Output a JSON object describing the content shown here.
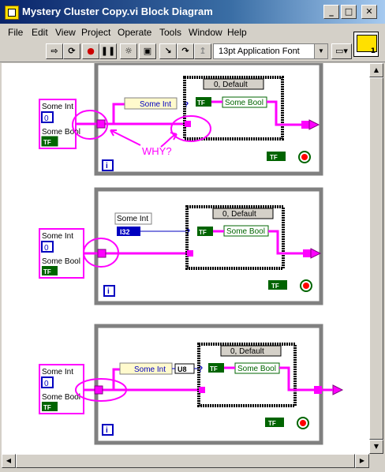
{
  "window": {
    "title": "Mystery Cluster Copy.vi Block Diagram"
  },
  "menu": [
    "File",
    "Edit",
    "View",
    "Project",
    "Operate",
    "Tools",
    "Window",
    "Help"
  ],
  "toolbar": {
    "font_label": "13pt Application Font"
  },
  "vi_icon": {
    "number": "1"
  },
  "annotation": {
    "text": "WHY?",
    "color": "#ff00ff"
  },
  "diagrams": [
    {
      "cluster_labels": [
        "Some Int",
        "0",
        "Some Bool",
        "TF"
      ],
      "bundle_label": "Some Int",
      "case_label": "0, Default",
      "case_bool_label": "Some Bool",
      "tf_constant": "TF",
      "loop_index": "i"
    },
    {
      "cluster_labels": [
        "Some Int",
        "0",
        "Some Bool",
        "TF"
      ],
      "bundle_label": "Some Int",
      "const_type": "I32",
      "case_label": "0, Default",
      "case_bool_label": "Some Bool",
      "tf_constant": "TF",
      "loop_index": "i"
    },
    {
      "cluster_labels": [
        "Some Int",
        "0",
        "Some Bool",
        "TF"
      ],
      "bundle_label": "Some Int",
      "convert_label": "U8",
      "case_label": "0, Default",
      "case_bool_label": "Some Bool",
      "tf_constant": "TF",
      "loop_index": "i"
    }
  ],
  "colors": {
    "wire_cluster": "#ff00ff",
    "loop_border": "#808080",
    "int_blue": "#0000c0",
    "bool_green": "#006400"
  }
}
